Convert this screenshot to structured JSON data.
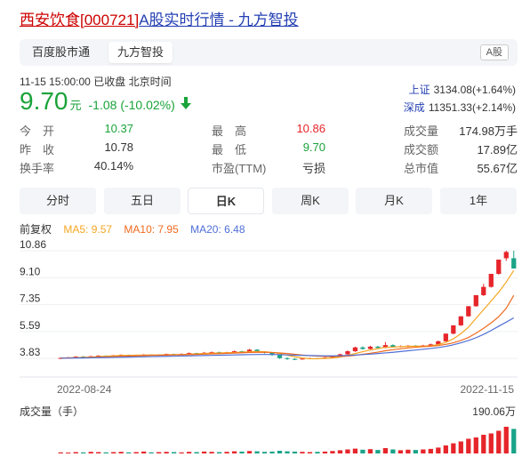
{
  "title": {
    "name_code": "西安饮食[000721]",
    "rest": "A股实时行情 - 九方智投"
  },
  "tabs": [
    {
      "label": "百度股市通",
      "active": false
    },
    {
      "label": "九方智投",
      "active": true
    }
  ],
  "market_badge": "A股",
  "status": {
    "datetime": "11-15 15:00:00",
    "state": "已收盘",
    "tz": "北京时间"
  },
  "quote": {
    "price": "9.70",
    "unit": "元",
    "change": "-1.08 (-10.02%)",
    "direction": "down"
  },
  "indices": [
    {
      "name": "上证",
      "value": "3134.08(+1.64%)"
    },
    {
      "name": "深成",
      "value": "11351.33(+2.14%)"
    }
  ],
  "stats": {
    "col1": [
      {
        "label": "今　开",
        "value": "10.37",
        "color": "green"
      },
      {
        "label": "昨　收",
        "value": "10.78",
        "color": "neutral"
      },
      {
        "label": "换手率",
        "value": "40.14%",
        "color": "neutral"
      }
    ],
    "col2": [
      {
        "label": "最　高",
        "value": "10.86",
        "color": "red"
      },
      {
        "label": "最　低",
        "value": "9.70",
        "color": "green"
      },
      {
        "label": "市盈(TTM)",
        "value": "亏损",
        "color": "neutral"
      }
    ],
    "col3": [
      {
        "label": "成交量",
        "value": "174.98万手",
        "color": "neutral"
      },
      {
        "label": "成交额",
        "value": "17.89亿",
        "color": "neutral"
      },
      {
        "label": "总市值",
        "value": "55.67亿",
        "color": "neutral"
      }
    ]
  },
  "periods": [
    {
      "label": "分时",
      "active": false
    },
    {
      "label": "五日",
      "active": false
    },
    {
      "label": "日K",
      "active": true
    },
    {
      "label": "周K",
      "active": false
    },
    {
      "label": "月K",
      "active": false
    },
    {
      "label": "1年",
      "active": false
    }
  ],
  "legend": {
    "adjust": "前复权",
    "ma5": "MA5: 9.57",
    "ma10": "MA10: 7.95",
    "ma20": "MA20: 6.48"
  },
  "colors": {
    "up": "#e6252a",
    "down": "#1aa388",
    "ma5": "#f5a623",
    "ma10": "#f06a1f",
    "ma20": "#4f6fd6",
    "link": "#2440b3"
  },
  "chart_data": {
    "type": "candlestick",
    "y_ticks": [
      "10.86",
      "9.10",
      "7.35",
      "5.59",
      "3.83"
    ],
    "ylim": [
      3.2,
      10.86
    ],
    "x_labels": [
      "2022-08-24",
      "2022-11-15"
    ],
    "volume_label": "成交量（手）",
    "volume_max_label": "190.06万",
    "candles": [
      [
        3.83,
        3.86,
        3.8,
        3.9
      ],
      [
        3.86,
        3.9,
        3.84,
        3.93
      ],
      [
        3.9,
        3.95,
        3.88,
        3.98
      ],
      [
        3.95,
        3.92,
        3.89,
        3.99
      ],
      [
        3.92,
        3.97,
        3.9,
        4.0
      ],
      [
        3.97,
        4.01,
        3.95,
        4.05
      ],
      [
        4.01,
        3.98,
        3.95,
        4.04
      ],
      [
        3.98,
        4.03,
        3.96,
        4.06
      ],
      [
        4.03,
        4.06,
        4.0,
        4.1
      ],
      [
        4.06,
        4.02,
        3.99,
        4.08
      ],
      [
        4.02,
        4.05,
        4.0,
        4.08
      ],
      [
        4.05,
        4.08,
        4.02,
        4.11
      ],
      [
        4.08,
        4.04,
        4.01,
        4.1
      ],
      [
        4.04,
        4.07,
        4.02,
        4.1
      ],
      [
        4.07,
        4.12,
        4.05,
        4.15
      ],
      [
        4.12,
        4.09,
        4.06,
        4.14
      ],
      [
        4.09,
        4.13,
        4.07,
        4.16
      ],
      [
        4.13,
        4.18,
        4.1,
        4.22
      ],
      [
        4.18,
        4.14,
        4.1,
        4.2
      ],
      [
        4.14,
        4.2,
        4.12,
        4.25
      ],
      [
        4.2,
        4.24,
        4.16,
        4.28
      ],
      [
        4.24,
        4.19,
        4.15,
        4.27
      ],
      [
        4.19,
        4.23,
        4.16,
        4.26
      ],
      [
        4.23,
        4.3,
        4.2,
        4.34
      ],
      [
        4.3,
        4.25,
        4.2,
        4.33
      ],
      [
        4.25,
        4.4,
        4.22,
        4.45
      ],
      [
        4.4,
        4.28,
        4.24,
        4.44
      ],
      [
        4.28,
        4.2,
        4.15,
        4.3
      ],
      [
        4.2,
        4.05,
        4.0,
        4.22
      ],
      [
        4.05,
        3.85,
        3.8,
        4.07
      ],
      [
        3.85,
        3.8,
        3.74,
        3.9
      ],
      [
        3.8,
        3.78,
        3.72,
        3.84
      ],
      [
        3.78,
        3.82,
        3.75,
        3.86
      ],
      [
        3.82,
        3.84,
        3.78,
        3.88
      ],
      [
        3.84,
        3.83,
        3.79,
        3.87
      ],
      [
        3.83,
        3.88,
        3.8,
        3.92
      ],
      [
        3.88,
        3.95,
        3.85,
        3.99
      ],
      [
        3.95,
        4.1,
        3.92,
        4.14
      ],
      [
        4.1,
        4.3,
        4.06,
        4.35
      ],
      [
        4.3,
        4.55,
        4.26,
        4.6
      ],
      [
        4.55,
        4.45,
        4.4,
        4.62
      ],
      [
        4.45,
        4.6,
        4.42,
        4.66
      ],
      [
        4.6,
        4.52,
        4.48,
        4.65
      ],
      [
        4.52,
        4.7,
        4.5,
        4.9
      ],
      [
        4.7,
        4.58,
        4.54,
        4.75
      ],
      [
        4.58,
        4.62,
        4.55,
        4.68
      ],
      [
        4.62,
        4.66,
        4.58,
        4.7
      ],
      [
        4.66,
        4.6,
        4.56,
        4.7
      ],
      [
        4.6,
        4.68,
        4.58,
        4.72
      ],
      [
        4.68,
        4.75,
        4.64,
        4.8
      ],
      [
        4.75,
        4.95,
        4.72,
        5.0
      ],
      [
        4.95,
        5.45,
        4.92,
        5.45
      ],
      [
        5.45,
        5.99,
        5.4,
        5.99
      ],
      [
        5.99,
        6.58,
        5.95,
        6.58
      ],
      [
        6.58,
        7.24,
        6.55,
        7.24
      ],
      [
        7.24,
        7.96,
        7.2,
        7.96
      ],
      [
        7.96,
        8.5,
        7.9,
        8.7
      ],
      [
        8.5,
        9.35,
        8.45,
        9.35
      ],
      [
        9.35,
        10.28,
        9.3,
        10.28
      ],
      [
        10.37,
        10.78,
        10.2,
        10.86
      ],
      [
        10.37,
        9.7,
        9.7,
        10.86
      ]
    ],
    "volumes_pct": [
      4,
      3,
      5,
      4,
      6,
      5,
      4,
      5,
      6,
      4,
      5,
      7,
      4,
      5,
      6,
      5,
      4,
      6,
      5,
      7,
      6,
      5,
      6,
      8,
      7,
      9,
      8,
      6,
      7,
      10,
      8,
      7,
      6,
      5,
      6,
      7,
      9,
      12,
      15,
      18,
      14,
      16,
      13,
      20,
      15,
      12,
      14,
      13,
      15,
      17,
      22,
      30,
      38,
      45,
      55,
      60,
      70,
      75,
      85,
      100,
      92
    ],
    "ma5": [
      3.85,
      3.87,
      3.88,
      3.9,
      3.92,
      3.95,
      3.98,
      4.0,
      4.02,
      4.03,
      4.04,
      4.05,
      4.06,
      4.06,
      4.07,
      4.08,
      4.09,
      4.11,
      4.13,
      4.15,
      4.17,
      4.19,
      4.2,
      4.22,
      4.24,
      4.27,
      4.28,
      4.27,
      4.22,
      4.15,
      4.04,
      3.94,
      3.86,
      3.81,
      3.81,
      3.83,
      3.86,
      3.92,
      4.02,
      4.15,
      4.27,
      4.38,
      4.47,
      4.56,
      4.57,
      4.6,
      4.62,
      4.63,
      4.63,
      4.66,
      4.73,
      4.88,
      5.11,
      5.45,
      5.87,
      6.45,
      7.01,
      7.58,
      8.15,
      8.81,
      9.57
    ],
    "ma10": [
      3.85,
      3.86,
      3.87,
      3.88,
      3.9,
      3.92,
      3.93,
      3.95,
      3.97,
      3.99,
      4.0,
      4.02,
      4.03,
      4.04,
      4.05,
      4.06,
      4.07,
      4.08,
      4.09,
      4.11,
      4.13,
      4.14,
      4.16,
      4.18,
      4.2,
      4.22,
      4.23,
      4.23,
      4.22,
      4.19,
      4.15,
      4.1,
      4.05,
      4.01,
      3.98,
      3.96,
      3.95,
      3.96,
      3.98,
      4.03,
      4.1,
      4.17,
      4.24,
      4.33,
      4.4,
      4.46,
      4.52,
      4.56,
      4.6,
      4.63,
      4.67,
      4.75,
      4.85,
      5.0,
      5.2,
      5.48,
      5.8,
      6.15,
      6.55,
      7.1,
      7.95
    ],
    "ma20": [
      3.85,
      3.85,
      3.86,
      3.86,
      3.87,
      3.88,
      3.89,
      3.9,
      3.91,
      3.92,
      3.93,
      3.94,
      3.95,
      3.96,
      3.97,
      3.98,
      3.99,
      4.0,
      4.01,
      4.02,
      4.03,
      4.04,
      4.05,
      4.06,
      4.07,
      4.08,
      4.09,
      4.09,
      4.09,
      4.08,
      4.06,
      4.04,
      4.03,
      4.02,
      4.01,
      4.0,
      4.0,
      4.01,
      4.03,
      4.05,
      4.08,
      4.11,
      4.15,
      4.19,
      4.23,
      4.28,
      4.33,
      4.38,
      4.43,
      4.48,
      4.54,
      4.62,
      4.72,
      4.85,
      5.0,
      5.18,
      5.4,
      5.65,
      5.93,
      6.2,
      6.48
    ]
  }
}
